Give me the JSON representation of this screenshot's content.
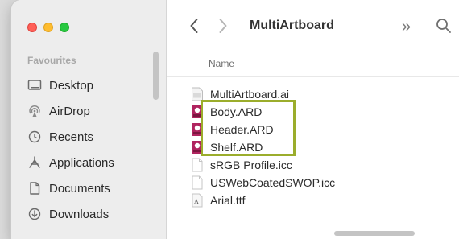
{
  "window": {
    "title": "MultiArtboard"
  },
  "sidebar": {
    "section_title": "Favourites",
    "items": [
      {
        "label": "Desktop",
        "icon": "desktop-icon"
      },
      {
        "label": "AirDrop",
        "icon": "airdrop-icon"
      },
      {
        "label": "Recents",
        "icon": "clock-icon"
      },
      {
        "label": "Applications",
        "icon": "applications-icon"
      },
      {
        "label": "Documents",
        "icon": "document-icon"
      },
      {
        "label": "Downloads",
        "icon": "download-icon"
      }
    ]
  },
  "toolbar": {
    "back_glyph": "‹",
    "forward_glyph": "›",
    "more_glyph": "»"
  },
  "list": {
    "column_header": "Name",
    "files": [
      {
        "name": "MultiArtboard.ai",
        "icon": "ai-file-icon"
      },
      {
        "name": "Body.ARD",
        "icon": "ard-file-icon"
      },
      {
        "name": "Header.ARD",
        "icon": "ard-file-icon"
      },
      {
        "name": "Shelf.ARD",
        "icon": "ard-file-icon"
      },
      {
        "name": "sRGB Profile.icc",
        "icon": "blank-file-icon"
      },
      {
        "name": "USWebCoatedSWOP.icc",
        "icon": "blank-file-icon"
      },
      {
        "name": "Arial.ttf",
        "icon": "font-file-icon"
      }
    ]
  },
  "colors": {
    "highlight": "#9bad2c",
    "ard_icon": "#b0245f",
    "close": "#ff5f57",
    "minimize": "#febc2e",
    "zoom": "#28c840"
  }
}
